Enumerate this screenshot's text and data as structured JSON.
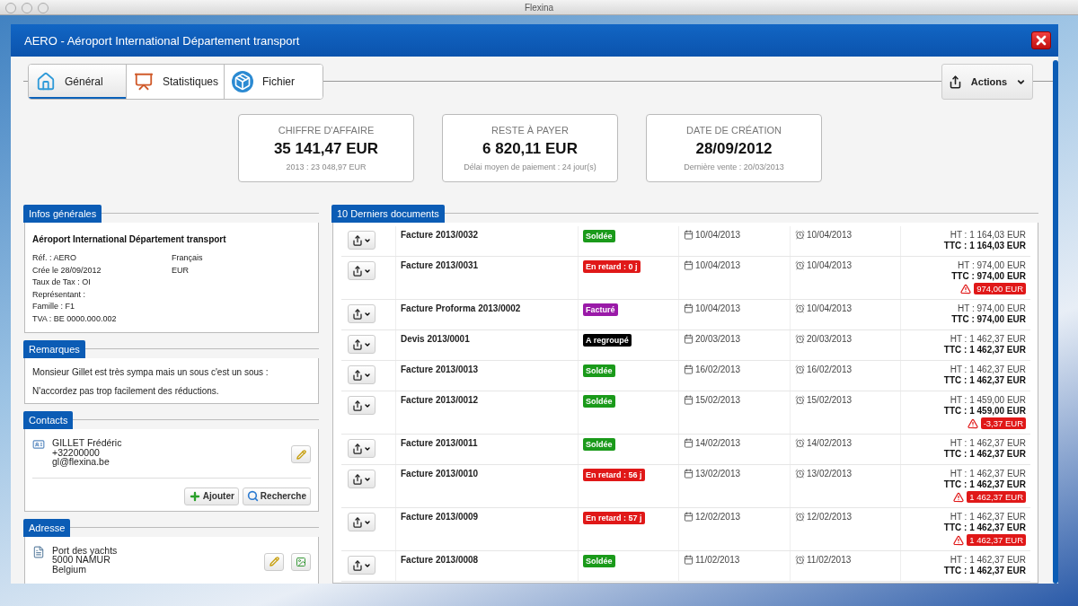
{
  "app_title": "Flexina",
  "window": {
    "title": "AERO - Aéroport International Département transport"
  },
  "tabs": [
    {
      "kind": "home",
      "label": "Général",
      "selected": true
    },
    {
      "kind": "stats",
      "label": "Statistiques",
      "selected": false
    },
    {
      "kind": "file",
      "label": "Fichier",
      "selected": false
    }
  ],
  "actions_button": {
    "label": "Actions"
  },
  "stats": [
    {
      "title": "CHIFFRE D'AFFAIRE",
      "value": "35 141,47 EUR",
      "note": "2013 : 23 048,97 EUR"
    },
    {
      "title": "RESTE À PAYER",
      "value": "6 820,11 EUR",
      "note": "Délai moyen de paiement : 24 jour(s)"
    },
    {
      "title": "DATE DE CRÉATION",
      "value": "28/09/2012",
      "note": "Dernière vente : 20/03/2013"
    }
  ],
  "info": {
    "heading": "Infos générales",
    "company": "Aéroport International Département transport",
    "fields_left": [
      "Réf. : AERO",
      "Crée le 28/09/2012",
      "Taux de Tax : OI",
      "Représentant :",
      "Famille : F1",
      "TVA : BE 0000.000.002"
    ],
    "fields_right": [
      "Français",
      "EUR"
    ]
  },
  "remarks": {
    "heading": "Remarques",
    "lines": [
      "Monsieur Gillet est très sympa mais un sous c'est un sous :",
      "N'accordez pas trop facilement des réductions."
    ]
  },
  "contacts": {
    "heading": "Contacts",
    "items": [
      {
        "name": "GILLET Frédéric",
        "phone": "+32200000",
        "email": "gl@flexina.be"
      }
    ],
    "buttons": [
      {
        "kind": "add",
        "label": "Ajouter"
      },
      {
        "kind": "search",
        "label": "Recherche"
      }
    ]
  },
  "address": {
    "heading": "Adresse",
    "lines": [
      "Port des yachts",
      "5000 NAMUR",
      "Belgium"
    ]
  },
  "documents": {
    "heading": "10 Derniers documents",
    "rows": [
      {
        "name": "Facture 2013/0032",
        "status": {
          "label": "Soldée",
          "color": "#1a9a1a"
        },
        "date": "10/04/2013",
        "due": "10/04/2013",
        "ht": "HT : 1 164,03 EUR",
        "ttc": "TTC : 1 164,03 EUR"
      },
      {
        "name": "Facture 2013/0031",
        "status": {
          "label": "En retard : 0 j",
          "color": "#e01818"
        },
        "date": "10/04/2013",
        "due": "10/04/2013",
        "ht": "HT : 974,00 EUR",
        "ttc": "TTC : 974,00 EUR",
        "overdue": "974,00 EUR"
      },
      {
        "name": "Facture Proforma 2013/0002",
        "status": {
          "label": "Facturé",
          "color": "#9a1aa8"
        },
        "date": "10/04/2013",
        "due": "10/04/2013",
        "ht": "HT : 974,00 EUR",
        "ttc": "TTC : 974,00 EUR"
      },
      {
        "name": "Devis 2013/0001",
        "status": {
          "label": "A regroupé",
          "color": "#000000"
        },
        "date": "20/03/2013",
        "due": "20/03/2013",
        "ht": "HT : 1 462,37 EUR",
        "ttc": "TTC : 1 462,37 EUR"
      },
      {
        "name": "Facture 2013/0013",
        "status": {
          "label": "Soldée",
          "color": "#1a9a1a"
        },
        "date": "16/02/2013",
        "due": "16/02/2013",
        "ht": "HT : 1 462,37 EUR",
        "ttc": "TTC : 1 462,37 EUR"
      },
      {
        "name": "Facture 2013/0012",
        "status": {
          "label": "Soldée",
          "color": "#1a9a1a"
        },
        "date": "15/02/2013",
        "due": "15/02/2013",
        "ht": "HT : 1 459,00 EUR",
        "ttc": "TTC : 1 459,00 EUR",
        "overdue": "-3,37 EUR"
      },
      {
        "name": "Facture 2013/0011",
        "status": {
          "label": "Soldée",
          "color": "#1a9a1a"
        },
        "date": "14/02/2013",
        "due": "14/02/2013",
        "ht": "HT : 1 462,37 EUR",
        "ttc": "TTC : 1 462,37 EUR"
      },
      {
        "name": "Facture 2013/0010",
        "status": {
          "label": "En retard : 56 j",
          "color": "#e01818"
        },
        "date": "13/02/2013",
        "due": "13/02/2013",
        "ht": "HT : 1 462,37 EUR",
        "ttc": "TTC : 1 462,37 EUR",
        "overdue": "1 462,37 EUR"
      },
      {
        "name": "Facture 2013/0009",
        "status": {
          "label": "En retard : 57 j",
          "color": "#e01818"
        },
        "date": "12/02/2013",
        "due": "12/02/2013",
        "ht": "HT : 1 462,37 EUR",
        "ttc": "TTC : 1 462,37 EUR",
        "overdue": "1 462,37 EUR"
      },
      {
        "name": "Facture 2013/0008",
        "status": {
          "label": "Soldée",
          "color": "#1a9a1a"
        },
        "date": "11/02/2013",
        "due": "11/02/2013",
        "ht": "HT : 1 462,37 EUR",
        "ttc": "TTC : 1 462,37 EUR"
      }
    ]
  }
}
